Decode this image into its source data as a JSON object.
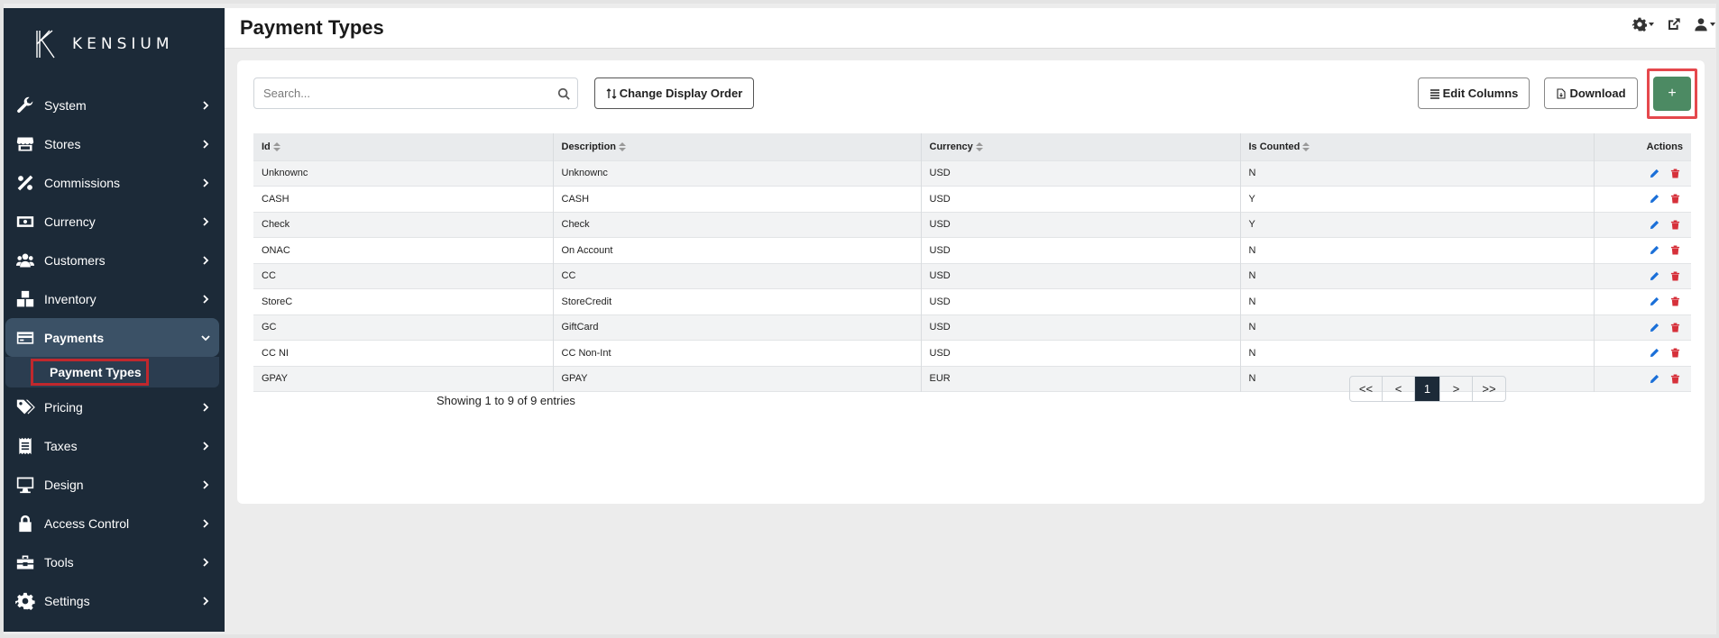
{
  "brand": {
    "name": "KENSIUM"
  },
  "sidebar": {
    "items": [
      {
        "label": "System",
        "icon": "wrench-icon"
      },
      {
        "label": "Stores",
        "icon": "store-icon"
      },
      {
        "label": "Commissions",
        "icon": "percent-icon"
      },
      {
        "label": "Currency",
        "icon": "money-bill-icon"
      },
      {
        "label": "Customers",
        "icon": "users-icon"
      },
      {
        "label": "Inventory",
        "icon": "boxes-icon"
      },
      {
        "label": "Payments",
        "icon": "credit-card-icon",
        "expanded": true
      },
      {
        "label": "Pricing",
        "icon": "tags-icon"
      },
      {
        "label": "Taxes",
        "icon": "receipt-icon"
      },
      {
        "label": "Design",
        "icon": "desktop-icon"
      },
      {
        "label": "Access Control",
        "icon": "lock-icon"
      },
      {
        "label": "Tools",
        "icon": "toolbox-icon"
      },
      {
        "label": "Settings",
        "icon": "gear-icon"
      }
    ],
    "sub_item": "Payment Types"
  },
  "header": {
    "title": "Payment Types"
  },
  "toolbar": {
    "search_placeholder": "Search...",
    "change_order_label": "Change Display Order",
    "edit_columns_label": "Edit Columns",
    "download_label": "Download",
    "add_label": "+"
  },
  "table": {
    "columns": [
      "Id",
      "Description",
      "Currency",
      "Is Counted",
      "Actions"
    ],
    "rows": [
      [
        "Unknownc",
        "Unknownc",
        "USD",
        "N"
      ],
      [
        "CASH",
        "CASH",
        "USD",
        "Y"
      ],
      [
        "Check",
        "Check",
        "USD",
        "Y"
      ],
      [
        "ONAC",
        "On Account",
        "USD",
        "N"
      ],
      [
        "CC",
        "CC",
        "USD",
        "N"
      ],
      [
        "StoreC",
        "StoreCredit",
        "USD",
        "N"
      ],
      [
        "GC",
        "GiftCard",
        "USD",
        "N"
      ],
      [
        "CC NI",
        "CC Non-Int",
        "USD",
        "N"
      ],
      [
        "GPAY",
        "GPAY",
        "EUR",
        "N"
      ]
    ]
  },
  "footer": {
    "info": "Showing 1 to 9 of 9 entries",
    "pager": [
      "<<",
      "<",
      "1",
      ">",
      ">>"
    ],
    "current_page": "1"
  },
  "colors": {
    "sidebar_bg": "#1c2a38",
    "active_bg": "#3b5166",
    "add_button": "#4c8a63",
    "edit_icon": "#1a6fd8",
    "delete_icon": "#d6303a",
    "highlight": "#e5484d"
  }
}
